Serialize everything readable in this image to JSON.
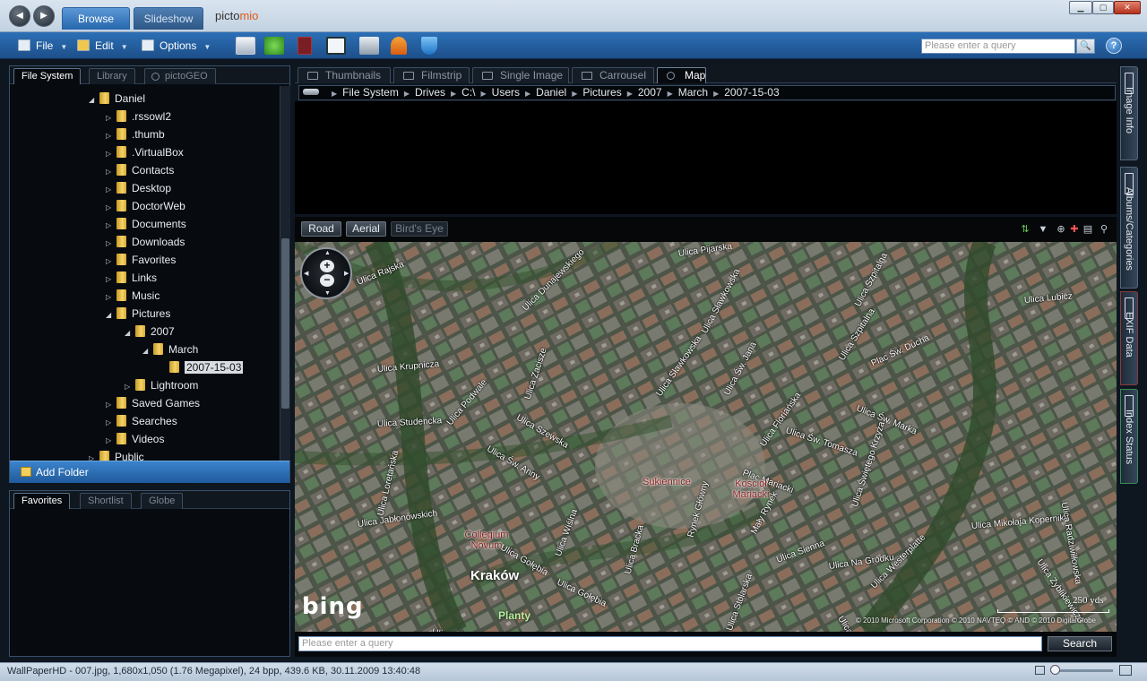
{
  "app": {
    "logo_text": "picto",
    "logo_mio": "mio"
  },
  "top_tabs": {
    "browse": "Browse",
    "slideshow": "Slideshow"
  },
  "toolbar": {
    "file": "File",
    "edit": "Edit",
    "options": "Options",
    "search_placeholder": "Please enter a query",
    "help": "?"
  },
  "left_tabs": [
    "File System",
    "Library",
    "pictoGEO"
  ],
  "tree": [
    {
      "label": "Daniel",
      "level": 0,
      "expanded": true
    },
    {
      "label": ".rssowl2",
      "level": 1
    },
    {
      "label": ".thumb",
      "level": 1
    },
    {
      "label": ".VirtualBox",
      "level": 1
    },
    {
      "label": "Contacts",
      "level": 1
    },
    {
      "label": "Desktop",
      "level": 1
    },
    {
      "label": "DoctorWeb",
      "level": 1
    },
    {
      "label": "Documents",
      "level": 1
    },
    {
      "label": "Downloads",
      "level": 1
    },
    {
      "label": "Favorites",
      "level": 1
    },
    {
      "label": "Links",
      "level": 1
    },
    {
      "label": "Music",
      "level": 1
    },
    {
      "label": "Pictures",
      "level": 1,
      "expanded": true
    },
    {
      "label": "2007",
      "level": 2,
      "expanded": true
    },
    {
      "label": "March",
      "level": 3,
      "expanded": true
    },
    {
      "label": "2007-15-03",
      "level": 4,
      "selected": true
    },
    {
      "label": "Lightroom",
      "level": 2
    },
    {
      "label": "Saved Games",
      "level": 1
    },
    {
      "label": "Searches",
      "level": 1
    },
    {
      "label": "Videos",
      "level": 1
    },
    {
      "label": "Public",
      "level": 0
    }
  ],
  "add_folder": "Add Folder",
  "lower_tabs": [
    "Favorites",
    "Shortlist",
    "Globe"
  ],
  "view_tabs": [
    "Thumbnails",
    "Filmstrip",
    "Single Image",
    "Carrousel",
    "Map"
  ],
  "breadcrumb": [
    "File System",
    "Drives",
    "C:\\",
    "Users",
    "Daniel",
    "Pictures",
    "2007",
    "March",
    "2007-15-03"
  ],
  "map_modes": {
    "road": "Road",
    "aerial": "Aerial",
    "birds_eye": "Bird's Eye"
  },
  "map": {
    "streets": [
      "Ulica Pijarska",
      "Ulica Dunajewskiego",
      "Ulica Sławkowska",
      "Ulica Rajska",
      "Ulica Lubicz",
      "Ulica Szpitalna",
      "Ulica Krupnicza",
      "Ulica Podwale",
      "Ulica Sławkowska",
      "Ulica Św. Jana",
      "Plac Św. Ducha",
      "Ulica Studencka",
      "Ulica Szewska",
      "Ulica Floriańska",
      "Ulica Św. Marka",
      "Ulica Św. Tomasza",
      "Ulica Szpitalna",
      "Ulica Św. Anny",
      "Plac Mariacki",
      "Ulica Świętego Krzyża",
      "Ulica Loretańska",
      "Ulica Jabłonowskich",
      "Ulica Gołębia",
      "Ulica Wiślna",
      "Ulica Bracka",
      "Rynek Główny",
      "Mały Rynek",
      "Ulica Sienna",
      "Ulica Westerplatte",
      "Ulica Mikołaja Kopernika",
      "Ulica Radziwiłłowska",
      "Ulica Zyblikiewicza",
      "Ulica Na Gródku",
      "Ulica Sienna",
      "Ulica Stolarska",
      "Ulica Gołębia",
      "Ulica Zacisze",
      "Ulica Bocheńska"
    ],
    "poi": [
      "Sukiennice",
      "Kościół Mariacki",
      "Collegium Novum"
    ],
    "city": "Kraków",
    "district": "Planty",
    "provider": "bing",
    "scale": "250 yds",
    "copyright": "© 2010 Microsoft Corporation   © 2010 NAVTEQ   © AND   © 2010 DigitalGlobe"
  },
  "map_search": {
    "placeholder": "Please enter a query",
    "button": "Search"
  },
  "side_tabs": [
    "Image Info",
    "Albums/Categories",
    "EXIF Data",
    "Index Status"
  ],
  "status": "WallPaperHD - 007.jpg, 1,680x1,050 (1.76 Megapixel), 24 bpp, 439.6 KB, 30.11.2009 13:40:48"
}
